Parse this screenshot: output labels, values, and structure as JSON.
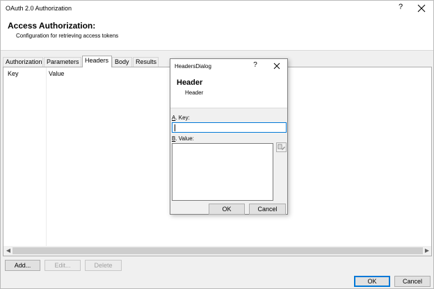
{
  "window": {
    "title": "OAuth 2.0 Authorization",
    "help_glyph": "?",
    "close_icon": "close-icon"
  },
  "header": {
    "title": "Access Authorization:",
    "subtitle": "Configuration for retrieving access tokens"
  },
  "tabs": [
    {
      "label": "Authorization",
      "active": false
    },
    {
      "label": "Parameters",
      "active": false
    },
    {
      "label": "Headers",
      "active": true
    },
    {
      "label": "Body",
      "active": false
    },
    {
      "label": "Results",
      "active": false
    }
  ],
  "grid": {
    "columns": [
      "Key",
      "Value"
    ],
    "rows": []
  },
  "buttons": {
    "add": "Add...",
    "edit": "Edit...",
    "delete": "Delete",
    "ok": "OK",
    "cancel": "Cancel"
  },
  "dialog": {
    "title": "HeadersDialog",
    "help_glyph": "?",
    "header_title": "Header",
    "header_subtitle": "Header",
    "key_label_mnemonic": "A",
    "key_label_text": ". Key:",
    "key_value": "",
    "value_label_mnemonic": "B",
    "value_label_text": ". Value:",
    "value_value": "",
    "ok": "OK",
    "cancel": "Cancel"
  },
  "colors": {
    "focus_blue": "#0078d7",
    "window_bg": "#f0f0f0"
  }
}
